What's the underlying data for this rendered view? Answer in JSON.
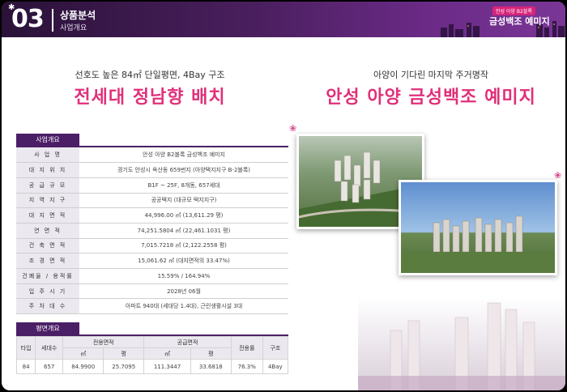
{
  "header": {
    "section_number": "03",
    "section_title": "상품분석",
    "section_subtitle": "사업개요",
    "brand_small": "안성 아양 B2블록",
    "brand_main": "금성백조 예미지"
  },
  "headline_left": {
    "sub": "선호도 높은 84㎡ 단일평면, 4Bay 구조",
    "main": "전세대 정남향 배치"
  },
  "headline_right": {
    "sub": "아양이 기다린 마지막 주거명작",
    "main": "안성 아양 금성백조 예미지"
  },
  "overview": {
    "tab_label": "사업개요",
    "rows": [
      {
        "label": "사 업 명",
        "value": "안성 아양 B2블록 금성백조 예미지"
      },
      {
        "label": "대 지 위 치",
        "value": "경기도 안성시 옥산동 659번지 (아양택지지구 B-2블록)"
      },
      {
        "label": "공 급 규 모",
        "value": "B1F ~ 25F, 8개동, 657세대"
      },
      {
        "label": "지 역 지 구",
        "value": "공공택지 (대규모 택지지구)"
      },
      {
        "label": "대 지 면 적",
        "value": "44,996.00 ㎡ (13,611.29 평)"
      },
      {
        "label": "연 면 적",
        "value": "74,251.5804 ㎡ (22,461.1031 평)"
      },
      {
        "label": "건 축 면 적",
        "value": "7,015.7218 ㎡ (2,122.2558 평)"
      },
      {
        "label": "조 경 면 적",
        "value": "15,061.62 ㎡ (대지면적의 33.47%)"
      },
      {
        "label": "건폐율 / 용적률",
        "value": "15.59% / 164.94%"
      },
      {
        "label": "입 주 시 기",
        "value": "2028년 06월"
      },
      {
        "label": "주 차 대 수",
        "value": "아파트 940대 (세대당 1.4대), 근린생활시설 3대"
      }
    ]
  },
  "floor_plan": {
    "tab_label": "평면개요",
    "headers": {
      "type": "타입",
      "units": "세대수",
      "exclusive": "전용면적",
      "supply": "공급면적",
      "ratio": "전용률",
      "structure": "구조",
      "sqm": "㎡",
      "pyeong": "평"
    },
    "rows": [
      {
        "type": "84",
        "units": "657",
        "ex_sqm": "84.9900",
        "ex_py": "25.7095",
        "su_sqm": "111.3447",
        "su_py": "33.6818",
        "ratio": "76.3%",
        "structure": "4Bay"
      }
    ]
  },
  "colors": {
    "header_purple": "#4a1f5e",
    "accent_pink": "#e0307a",
    "table_label_bg": "#ece8ef"
  }
}
